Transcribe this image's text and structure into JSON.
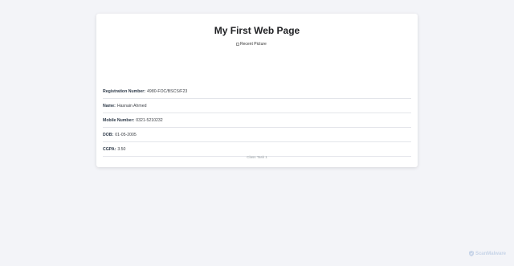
{
  "page": {
    "title": "My First Web Page",
    "image_alt": "Recent Picture"
  },
  "info": [
    {
      "label": "Registration Number:",
      "value": "4980-FOC/BSCS/F23"
    },
    {
      "label": "Name:",
      "value": "Hasnain Ahmed"
    },
    {
      "label": "Mobile Number:",
      "value": "0321-5210232"
    },
    {
      "label": "DOB:",
      "value": "01-05-2005"
    },
    {
      "label": "CGPA:",
      "value": "3.50"
    }
  ],
  "footer": {
    "text": "Class Task 1"
  },
  "watermark": {
    "text": "ScanMalware",
    "icon": "shield-icon"
  },
  "colors": {
    "background": "#f3f4f8",
    "card": "#ffffff",
    "label": "#2f3b4a",
    "footer_text": "#9aa0a6"
  }
}
